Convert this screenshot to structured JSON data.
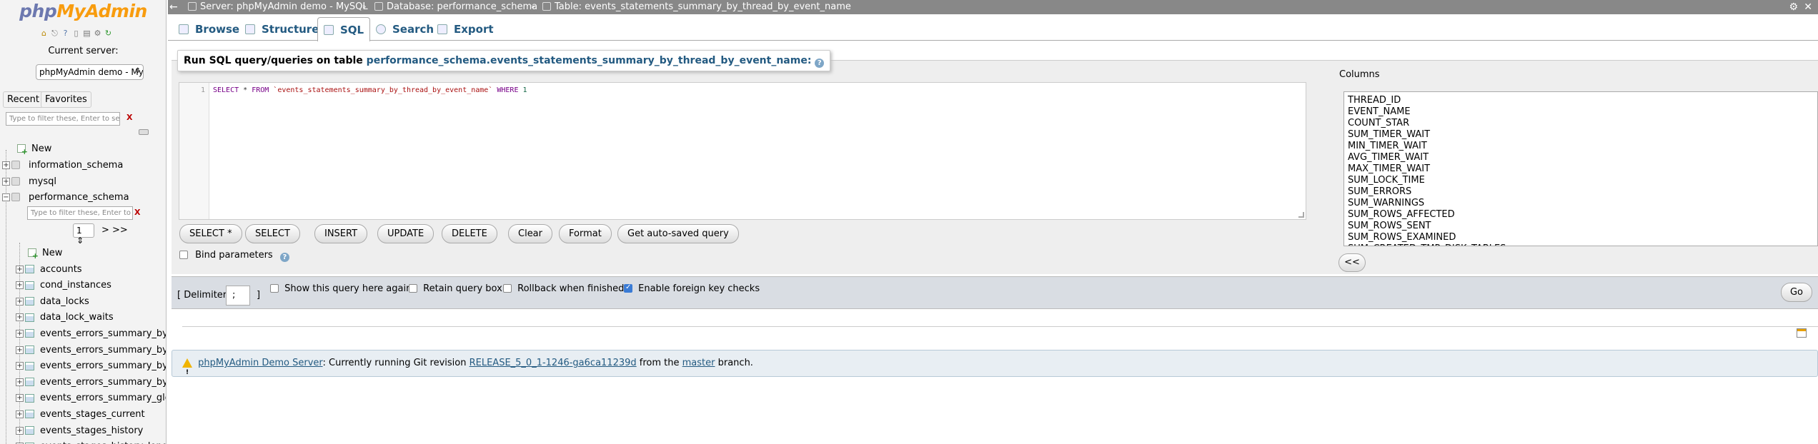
{
  "nav": {
    "logo_main": "php",
    "logo_accent": "MyAdmin",
    "current_server_label": "Current server:",
    "server_select_value": "phpMyAdmin demo - MyS",
    "tab_recent": "Recent",
    "tab_favorites": "Favorites",
    "filter_placeholder": "Type to filter these, Enter to search all",
    "filter_clear": "X",
    "tree": {
      "new_label": "New",
      "databases": [
        "information_schema",
        "mysql",
        "performance_schema"
      ],
      "db_filter_placeholder": "Type to filter these, Enter to search",
      "db_filter_clear": "X",
      "page_value": "1",
      "page_next": "> >>",
      "db_new_label": "New",
      "tables": [
        "accounts",
        "cond_instances",
        "data_locks",
        "data_lock_waits",
        "events_errors_summary_by_",
        "events_errors_summary_by_",
        "events_errors_summary_by_",
        "events_errors_summary_by_",
        "events_errors_summary_glob",
        "events_stages_current",
        "events_stages_history",
        "events_stages_history_long"
      ]
    }
  },
  "topbar": {
    "server": "Server: phpMyAdmin demo - MySQL",
    "database": "Database: performance_schema",
    "table": "Table: events_statements_summary_by_thread_by_event_name",
    "separator": "»"
  },
  "menu": {
    "tabs": [
      "Browse",
      "Structure",
      "SQL",
      "Search",
      "Export"
    ],
    "active": "SQL"
  },
  "sql": {
    "legend_prefix": "Run SQL query/queries on table",
    "legend_table": "performance_schema.events_statements_summary_by_thread_by_event_name:",
    "line_number": "1",
    "query_parts": {
      "select": "SELECT",
      "star": " * ",
      "from": "FROM",
      "table": " `events_statements_summary_by_thread_by_event_name` ",
      "where": "WHERE",
      "value": " 1"
    },
    "buttons": [
      "SELECT *",
      "SELECT",
      "INSERT",
      "UPDATE",
      "DELETE",
      "Clear",
      "Format",
      "Get auto-saved query"
    ],
    "bind_parameters": "Bind parameters"
  },
  "columns": {
    "label": "Columns",
    "items": [
      "THREAD_ID",
      "EVENT_NAME",
      "COUNT_STAR",
      "SUM_TIMER_WAIT",
      "MIN_TIMER_WAIT",
      "AVG_TIMER_WAIT",
      "MAX_TIMER_WAIT",
      "SUM_LOCK_TIME",
      "SUM_ERRORS",
      "SUM_WARNINGS",
      "SUM_ROWS_AFFECTED",
      "SUM_ROWS_SENT",
      "SUM_ROWS_EXAMINED",
      "SUM_CREATED_TMP_DISK_TABLES"
    ],
    "insert_button": "<<"
  },
  "options": {
    "delimiter_open": "[ Delimiter",
    "delimiter_value": ";",
    "delimiter_close": "]",
    "show_query_again": "Show this query here again",
    "retain_query_box": "Retain query box",
    "rollback_when_finished": "Rollback when finished",
    "enable_foreign_key_checks": "Enable foreign key checks",
    "go": "Go"
  },
  "notice": {
    "link_server": "phpMyAdmin Demo Server",
    "text_1": ": Currently running Git revision ",
    "link_revision": "RELEASE_5_0_1-1246-ga6ca11239d",
    "text_2": " from the ",
    "link_branch": "master",
    "text_3": " branch."
  },
  "colors": {
    "accent": "#235a81",
    "topbar_bg": "#888888",
    "logo_php": "#6c78af",
    "logo_myadmin": "#f89c0e"
  }
}
